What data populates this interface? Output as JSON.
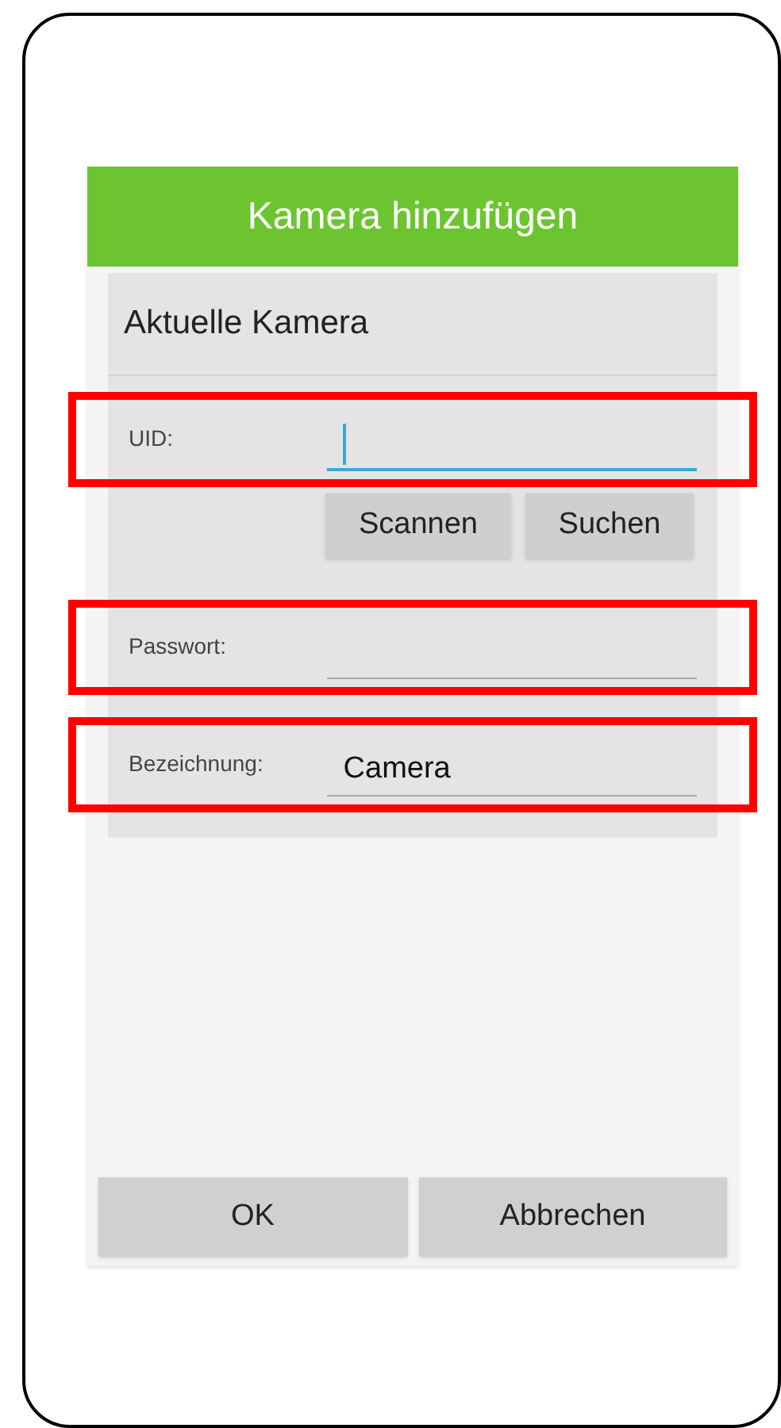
{
  "dialog": {
    "title": "Kamera hinzufügen"
  },
  "section": {
    "title": "Aktuelle Kamera"
  },
  "fields": [
    {
      "label": "UID:",
      "focused": true,
      "highlighted": true
    },
    {
      "label": "Passwort:",
      "focused": false,
      "highlighted": true
    },
    {
      "label": "Bezeichnung:",
      "value": "Camera",
      "focused": false,
      "highlighted": true
    }
  ],
  "field_actions": [
    "Scannen",
    "Suchen"
  ],
  "buttons": [
    "OK",
    "Abbrechen"
  ]
}
